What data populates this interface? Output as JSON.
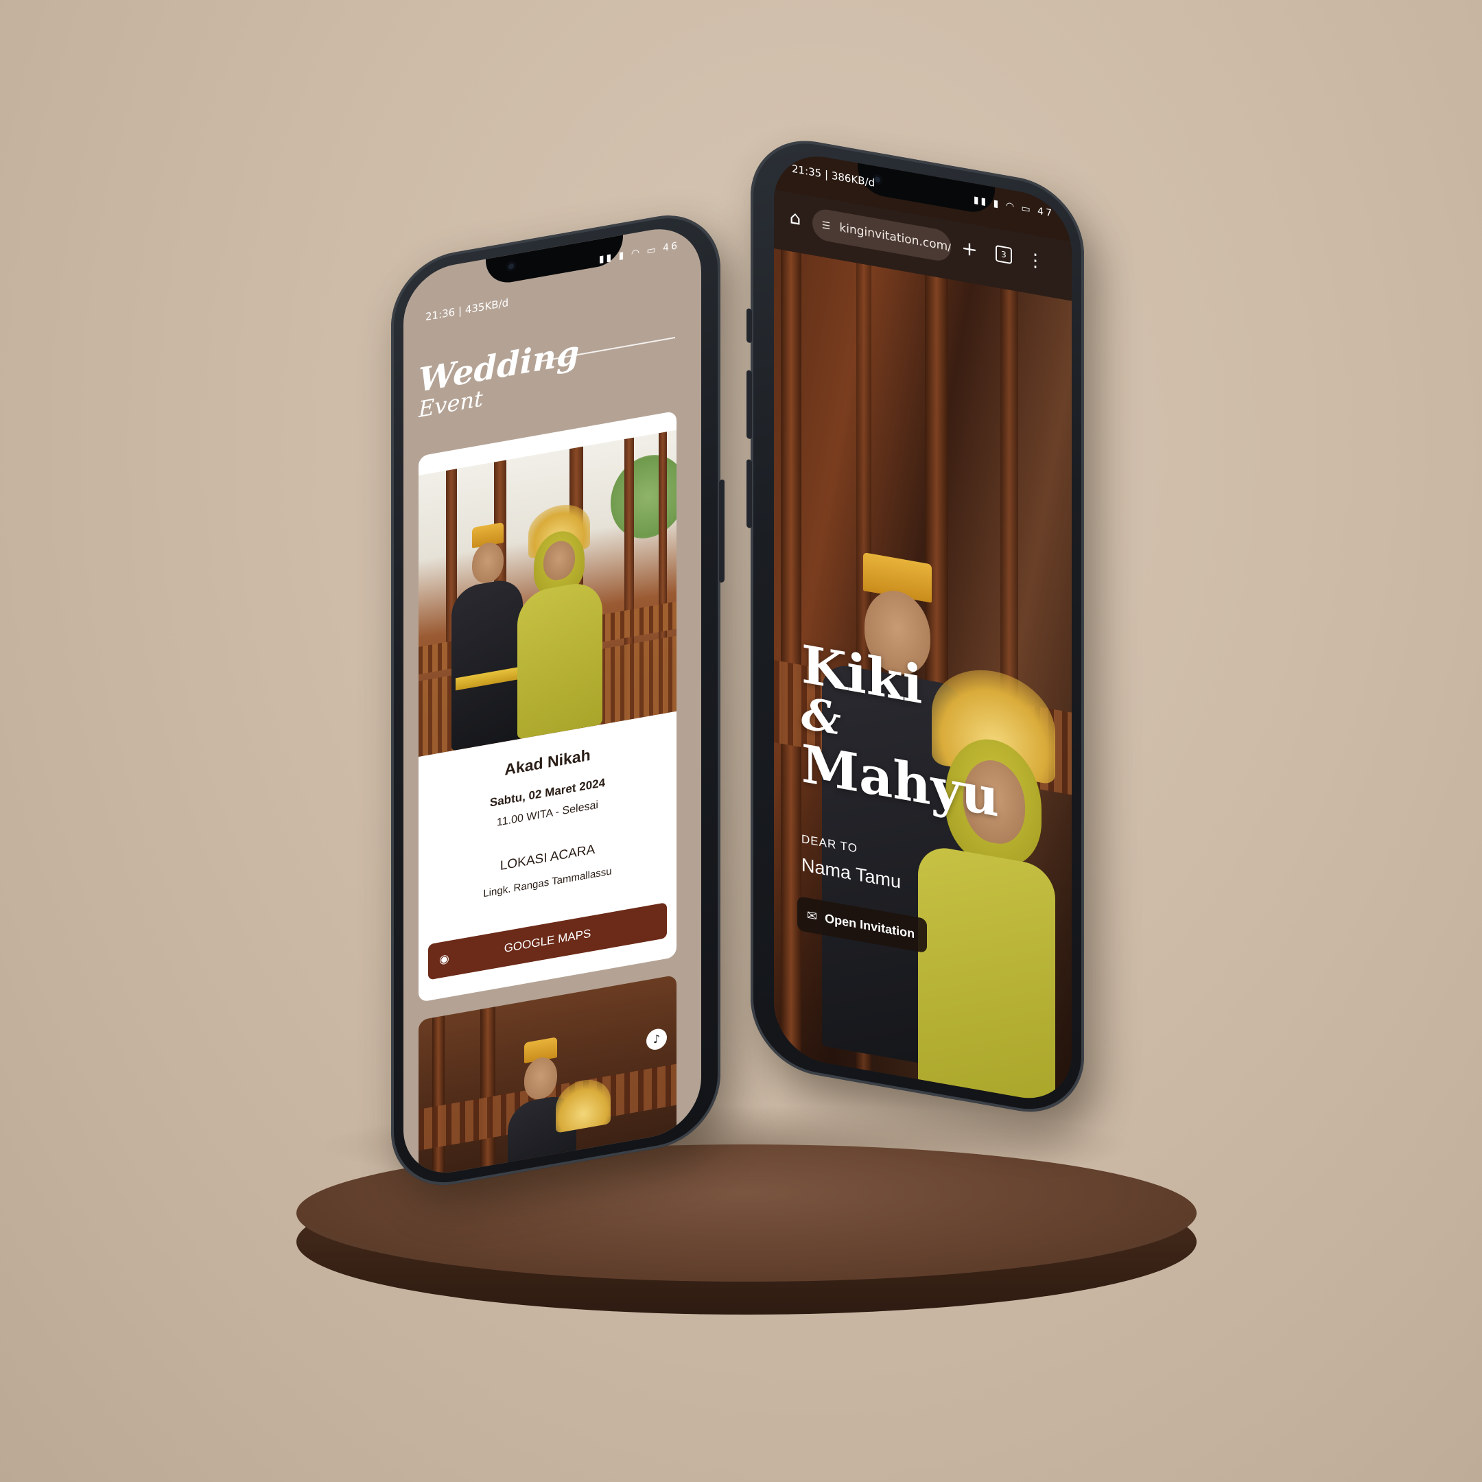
{
  "left_phone": {
    "status": {
      "time": "21:36 | 435KB/d",
      "icons": "▮▮ ▮ ◠ ▭",
      "battery": "46"
    },
    "heading": {
      "line1": "Wedding",
      "line2": "Event"
    },
    "event": {
      "title": "Akad Nikah",
      "date": "Sabtu, 02 Maret 2024",
      "time": "11.00 WITA - Selesai",
      "location_label": "LOKASI ACARA",
      "location_value": "Lingk. Rangas Tammallassu",
      "maps_button": "GOOGLE MAPS",
      "pin_icon": "◉"
    },
    "music_icon": "♪"
  },
  "right_phone": {
    "status": {
      "time": "21:35 | 386KB/d",
      "icons": "▮▮ ▮ ◠ ▭",
      "battery": "47"
    },
    "browser": {
      "home_icon": "⌂",
      "url": "kinginvitation.com/kiki-r",
      "tune_icon": "☰",
      "plus_icon": "+",
      "tabs_count": "3",
      "more_icon": "⋮"
    },
    "couple": {
      "name1": "Kiki",
      "ampersand": "&",
      "name2": "Mahyu"
    },
    "dear_label": "DEAR TO",
    "guest_name": "Nama Tamu",
    "open_button": {
      "label": "Open Invitation",
      "icon": "✉"
    }
  },
  "colors": {
    "background": "#cdbba7",
    "card_bg": "#b4a395",
    "maps_button": "#6c2a18",
    "podium": "#6a4733",
    "phone_frame": "#1a1d22"
  }
}
